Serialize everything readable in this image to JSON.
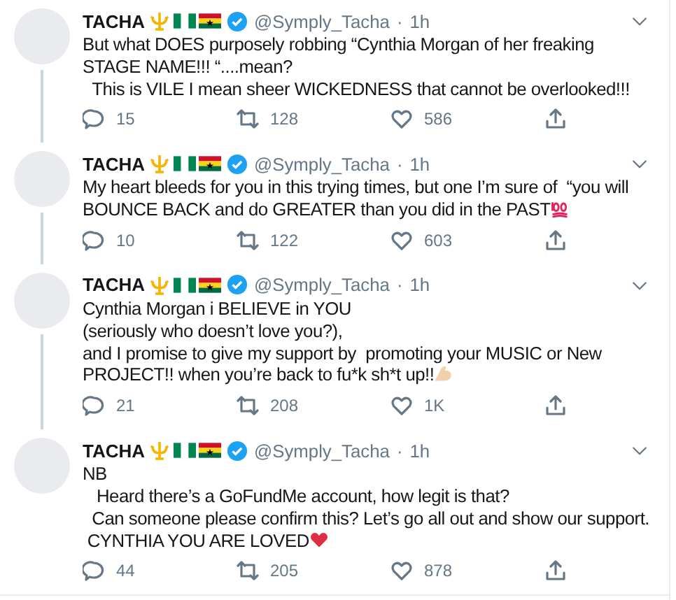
{
  "tweets": [
    {
      "name": "TACHA",
      "handle": "@Symply_Tacha",
      "dot": "·",
      "time": "1h",
      "text": "But what DOES purposely robbing “Cynthia Morgan of her freaking STAGE NAME!!! “....mean?\n  This is VILE I mean sheer WICKEDNESS that cannot be overlooked!!!",
      "replies": "15",
      "retweets": "128",
      "likes": "586",
      "thread": true
    },
    {
      "name": "TACHA",
      "handle": "@Symply_Tacha",
      "dot": "·",
      "time": "1h",
      "text": "My heart bleeds for you in this trying times, but one I’m sure of  “you will BOUNCE BACK and do GREATER than you did in the PAST",
      "end_emoji": {
        "kind": "hundred"
      },
      "replies": "10",
      "retweets": "122",
      "likes": "603",
      "thread": true
    },
    {
      "name": "TACHA",
      "handle": "@Symply_Tacha",
      "dot": "·",
      "time": "1h",
      "text": "Cynthia Morgan i BELIEVE in YOU\n(seriously who doesn’t love you?),\nand I promise to give my support by  promoting your MUSIC or New PROJECT!! when you’re back to fu*k sh*t up!!",
      "end_emoji": {
        "kind": "muscle"
      },
      "replies": "21",
      "retweets": "208",
      "likes": "1K",
      "thread": true
    },
    {
      "name": "TACHA",
      "handle": "@Symply_Tacha",
      "dot": "·",
      "time": "1h",
      "text": "NB\n   Heard there’s a GoFundMe account, how legit is that?\n  Can someone please confirm this? Let’s go all out and show our support.\n CYNTHIA YOU ARE LOVED",
      "end_emoji": {
        "kind": "heart"
      },
      "replies": "44",
      "retweets": "205",
      "likes": "878",
      "thread": false
    }
  ]
}
